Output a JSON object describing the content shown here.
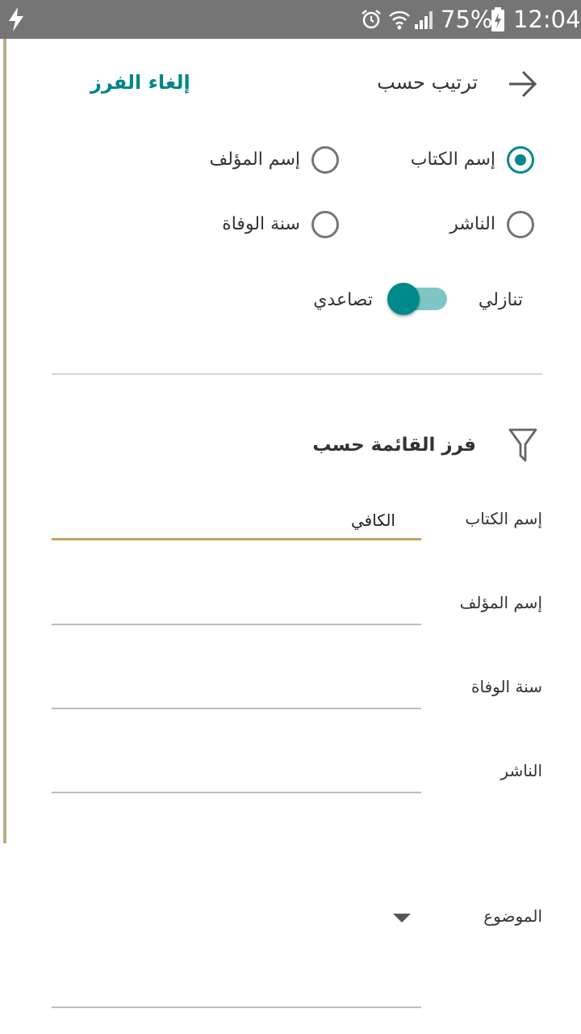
{
  "status_bar": {
    "battery": "75%",
    "time": "12:04"
  },
  "header": {
    "title": "ترتيب حسب",
    "cancel_label": "إلغاء الفرز"
  },
  "sort_options": [
    {
      "label": "إسم الكتاب",
      "checked": true
    },
    {
      "label": "إسم المؤلف",
      "checked": false
    },
    {
      "label": "الناشر",
      "checked": false
    },
    {
      "label": "سنة الوفاة",
      "checked": false
    }
  ],
  "order": {
    "descending_label": "تنازلي",
    "ascending_label": "تصاعدي",
    "ascending_on": true
  },
  "filter": {
    "title": "فرز القائمة حسب",
    "fields": [
      {
        "label": "إسم الكتاب",
        "value": "الكافي"
      },
      {
        "label": "إسم المؤلف",
        "value": ""
      },
      {
        "label": "سنة الوفاة",
        "value": ""
      },
      {
        "label": "الناشر",
        "value": ""
      }
    ],
    "subject": {
      "label": "الموضوع"
    }
  }
}
